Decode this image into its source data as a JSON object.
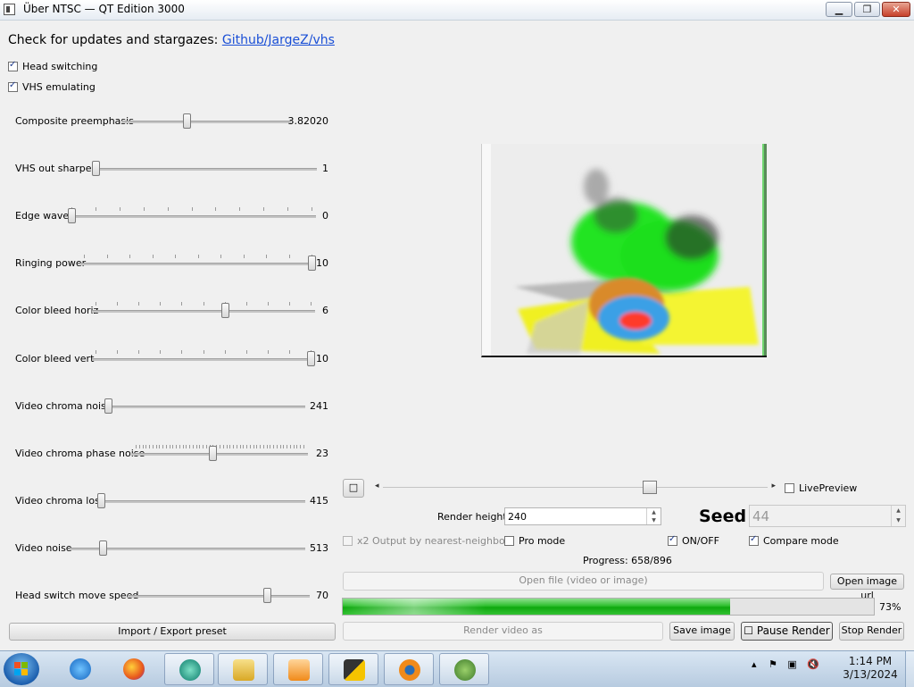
{
  "window": {
    "title": "Über NTSC — QT Edition 3000",
    "controls": {
      "minimize": "▁",
      "maximize": "❐",
      "close": "✕"
    }
  },
  "header": {
    "updates_text": "Check for updates and stargazes:",
    "updates_link": "Github/JargeZ/vhs"
  },
  "toggles": [
    {
      "label": "Head switching",
      "checked": true
    },
    {
      "label": "VHS emulating",
      "checked": true
    }
  ],
  "sliders": [
    {
      "label": "Composite preemphasis",
      "value": "3.82020",
      "fraction": 0.38,
      "ticks": 0
    },
    {
      "label": "VHS out sharpen",
      "value": "1",
      "fraction": 0.0,
      "ticks": 0
    },
    {
      "label": "Edge wave",
      "value": "0",
      "fraction": 0.0,
      "ticks": 10
    },
    {
      "label": "Ringing power",
      "value": "10",
      "fraction": 1.0,
      "ticks": 10
    },
    {
      "label": "Color bleed horiz",
      "value": "6",
      "fraction": 0.6,
      "ticks": 10
    },
    {
      "label": "Color bleed vert",
      "value": "10",
      "fraction": 1.0,
      "ticks": 10
    },
    {
      "label": "Video chroma noise",
      "value": "241",
      "fraction": 0.0,
      "ticks": 0
    },
    {
      "label": "Video chroma phase noise",
      "value": "23",
      "fraction": 0.46,
      "ticks": 50
    },
    {
      "label": "Video chroma loss",
      "value": "415",
      "fraction": 0.0,
      "ticks": 0
    },
    {
      "label": "Video noise",
      "value": "513",
      "fraction": 0.13,
      "ticks": 0
    },
    {
      "label": "Head switch move speed",
      "value": "70",
      "fraction": 0.78,
      "ticks": 0
    }
  ],
  "preset_button": "Import / Export preset",
  "timeline": {
    "fraction": 0.7,
    "left_arrow": "◂",
    "right_arrow": "▸",
    "small_button": "□"
  },
  "live_preview": {
    "label": "LivePreview",
    "checked": false
  },
  "render_height": {
    "label": "Render height",
    "value": "240"
  },
  "seed": {
    "label": "Seed",
    "value": "44"
  },
  "options": [
    {
      "label": "x2 Output by nearest-neighbor",
      "checked": false,
      "disabled": true
    },
    {
      "label": "Pro mode",
      "checked": false,
      "disabled": false
    },
    {
      "label": "ON/OFF",
      "checked": true,
      "disabled": false
    },
    {
      "label": "Compare mode",
      "checked": true,
      "disabled": false
    }
  ],
  "progress_text": "Progress: 658/896",
  "open_file": "Open file (video or image)",
  "open_image_url": "Open image url",
  "progress_percent": "73%",
  "progress_fraction": 0.73,
  "render_video": "Render video as",
  "save_image": "Save image",
  "pause_render": "Pause Render",
  "stop_render": "Stop Render",
  "taskbar": {
    "apps": [
      "internet-explorer",
      "firefox",
      "browser-app",
      "file-explorer",
      "media-player",
      "vhs-app",
      "blender",
      "network-tool"
    ],
    "time": "1:14 PM",
    "date": "3/13/2024"
  }
}
